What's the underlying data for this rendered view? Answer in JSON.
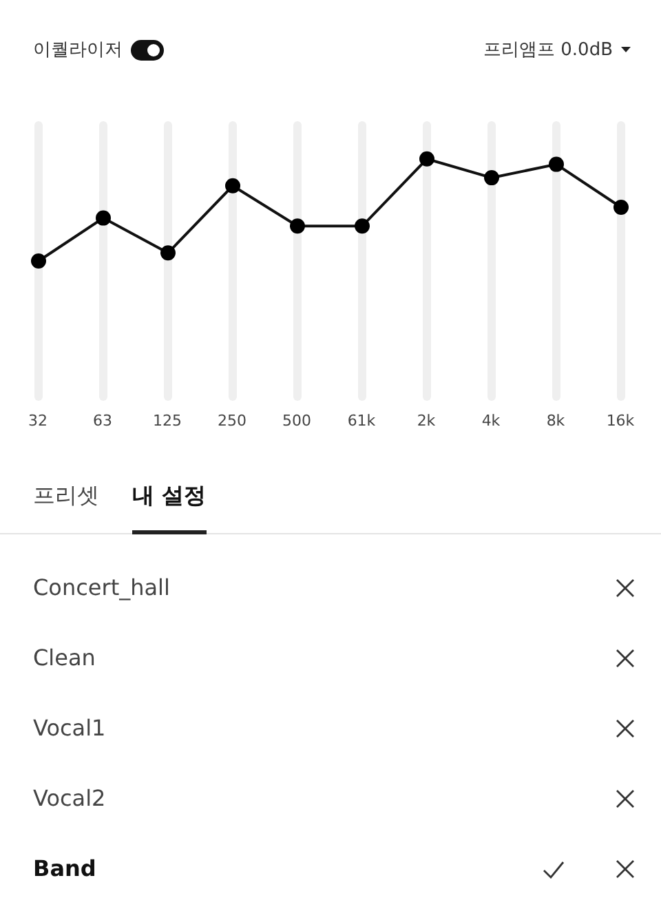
{
  "header": {
    "equalizer_label": "이퀄라이저",
    "equalizer_on": true,
    "preamp": "프리앰프 0.0dB"
  },
  "bands": [
    {
      "label": "32",
      "level": 0.5
    },
    {
      "label": "63",
      "level": 0.66
    },
    {
      "label": "125",
      "level": 0.53
    },
    {
      "label": "250",
      "level": 0.78
    },
    {
      "label": "500",
      "level": 0.63
    },
    {
      "label": "61k",
      "level": 0.63
    },
    {
      "label": "2k",
      "level": 0.88
    },
    {
      "label": "4k",
      "level": 0.81
    },
    {
      "label": "8k",
      "level": 0.86
    },
    {
      "label": "16k",
      "level": 0.7
    }
  ],
  "tabs": [
    {
      "label": "프리셋",
      "selected": false
    },
    {
      "label": "내 설정",
      "selected": true
    }
  ],
  "presets": [
    {
      "name": "Concert_hall",
      "selected": false
    },
    {
      "name": "Clean",
      "selected": false
    },
    {
      "name": "Vocal1",
      "selected": false
    },
    {
      "name": "Vocal2",
      "selected": false
    },
    {
      "name": "Band",
      "selected": true
    }
  ]
}
